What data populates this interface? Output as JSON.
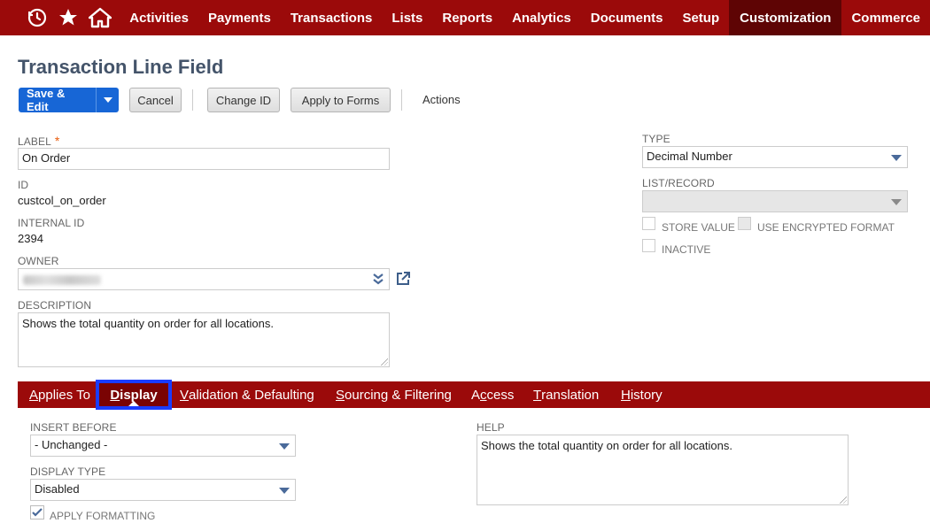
{
  "nav": {
    "items": [
      "Activities",
      "Payments",
      "Transactions",
      "Lists",
      "Reports",
      "Analytics",
      "Documents",
      "Setup",
      "Customization",
      "Commerce"
    ],
    "active": "Customization",
    "icons": [
      "recent-records-icon",
      "star-icon",
      "home-icon"
    ]
  },
  "page": {
    "title": "Transaction Line Field"
  },
  "toolbar": {
    "save_label": "Save & Edit",
    "cancel_label": "Cancel",
    "change_id_label": "Change ID",
    "apply_forms_label": "Apply to Forms",
    "actions_label": "Actions"
  },
  "fields": {
    "label": {
      "caption": "LABEL",
      "value": "On Order",
      "required_mark": "*"
    },
    "id": {
      "caption": "ID",
      "value": "custcol_on_order"
    },
    "internal_id": {
      "caption": "INTERNAL ID",
      "value": "2394"
    },
    "owner": {
      "caption": "OWNER"
    },
    "description": {
      "caption": "DESCRIPTION",
      "value": "Shows the total quantity on order for all locations."
    },
    "type": {
      "caption": "TYPE",
      "value": "Decimal Number"
    },
    "list_record": {
      "caption": "LIST/RECORD",
      "value": ""
    },
    "store_value": {
      "caption": "STORE VALUE",
      "checked": false
    },
    "use_encrypted": {
      "caption": "USE ENCRYPTED FORMAT",
      "checked": false
    },
    "inactive": {
      "caption": "INACTIVE",
      "checked": false
    }
  },
  "tabs": [
    {
      "prefix": "",
      "key": "A",
      "rest": "pplies To"
    },
    {
      "prefix": "",
      "key": "D",
      "rest": "isplay"
    },
    {
      "prefix": "",
      "key": "V",
      "rest": "alidation & Defaulting"
    },
    {
      "prefix": "",
      "key": "S",
      "rest": "ourcing & Filtering"
    },
    {
      "prefix": "A",
      "key": "c",
      "rest": "cess"
    },
    {
      "prefix": "",
      "key": "T",
      "rest": "ranslation"
    },
    {
      "prefix": "",
      "key": "H",
      "rest": "istory"
    }
  ],
  "display_tab": {
    "insert_before": {
      "caption": "INSERT BEFORE",
      "value": "- Unchanged -"
    },
    "display_type": {
      "caption": "DISPLAY TYPE",
      "value": "Disabled"
    },
    "apply_formatting": {
      "caption": "APPLY FORMATTING",
      "checked": true
    },
    "help": {
      "caption": "HELP",
      "value": "Shows the total quantity on order for all locations."
    }
  },
  "colors": {
    "nav_bg": "#9b0a0a",
    "nav_active": "#5e0404",
    "primary": "#1766d6",
    "highlight": "#1a3cff"
  }
}
